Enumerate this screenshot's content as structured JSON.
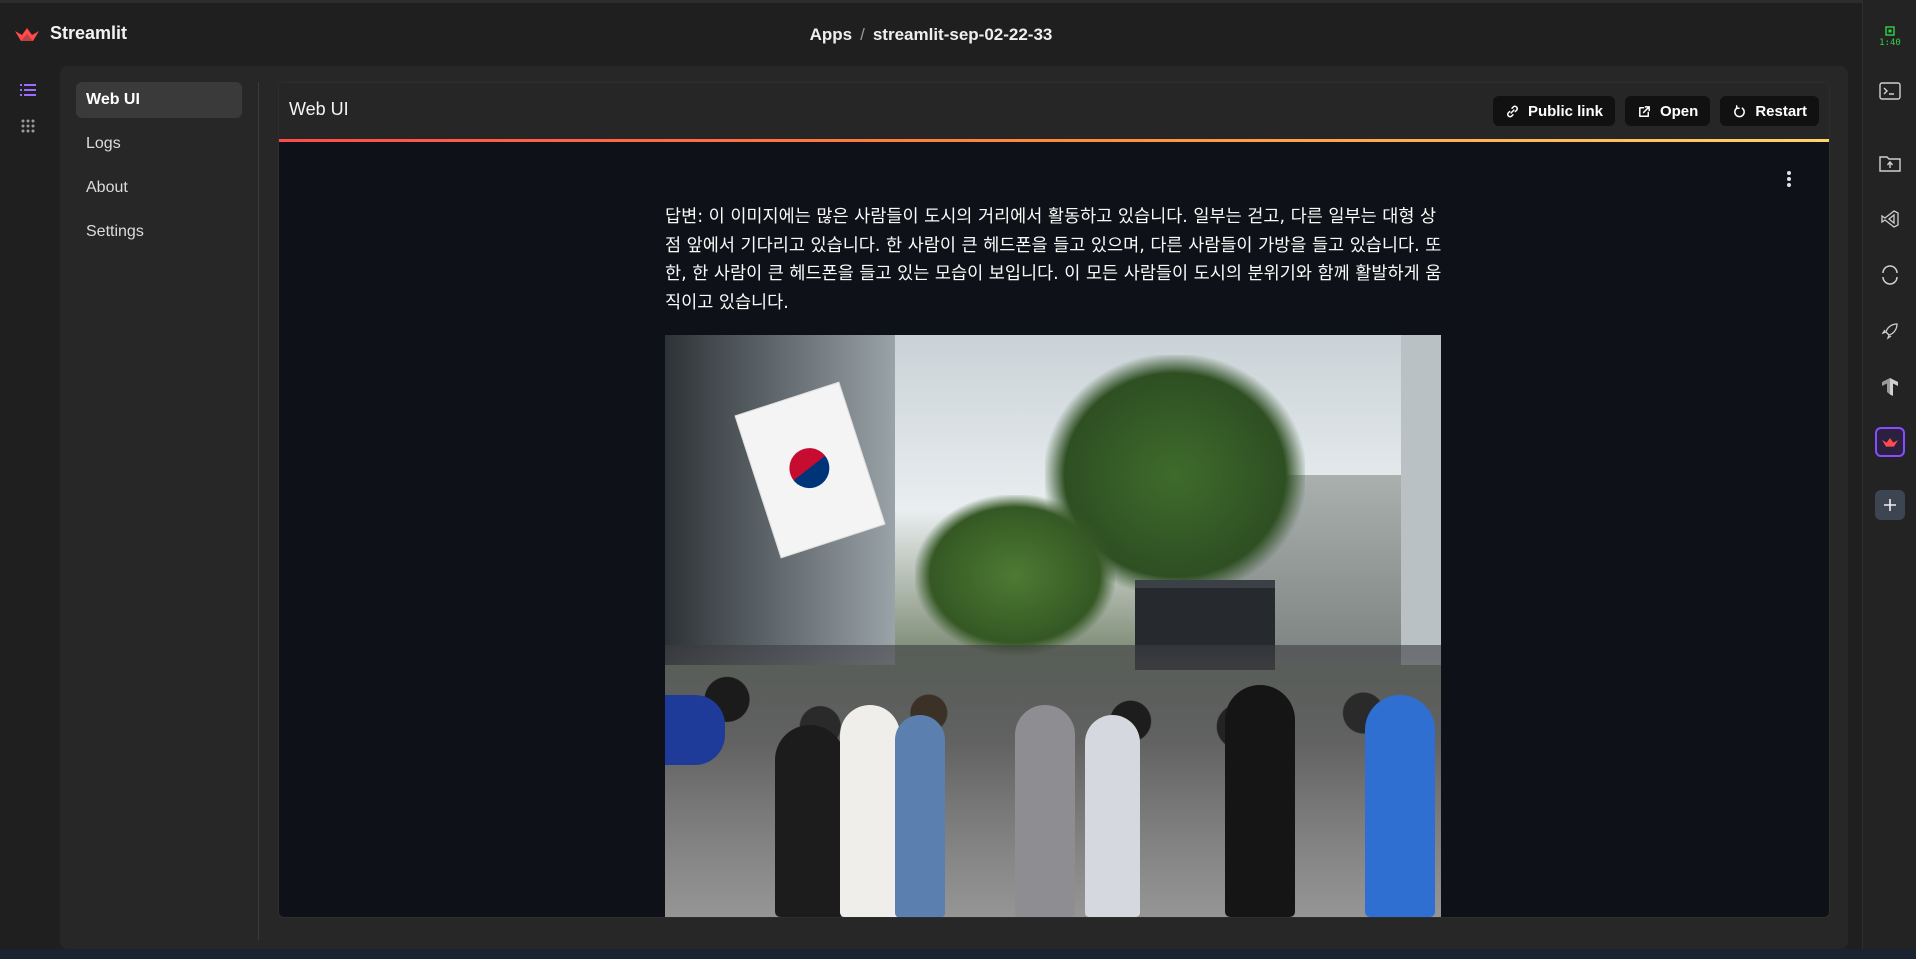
{
  "topbar": {
    "brand": "Streamlit",
    "breadcrumb": [
      "Apps",
      "streamlit-sep-02-22-33"
    ],
    "separator": "/"
  },
  "subnav": {
    "items": [
      {
        "label": "Web UI",
        "active": true
      },
      {
        "label": "Logs",
        "active": false
      },
      {
        "label": "About",
        "active": false
      },
      {
        "label": "Settings",
        "active": false
      }
    ]
  },
  "webframe": {
    "title": "Web UI",
    "buttons": {
      "public_link": "Public link",
      "open": "Open",
      "restart": "Restart"
    }
  },
  "app": {
    "answer": "답변: 이 이미지에는 많은 사람들이 도시의 거리에서 활동하고 있습니다. 일부는 걷고, 다른 일부는 대형 상점 앞에서 기다리고 있습니다. 한 사람이 큰 헤드폰을 들고 있으며, 다른 사람들이 가방을 들고 있습니다. 또한, 한 사람이 큰 헤드폰을 들고 있는 모습이 보입니다. 이 모든 사람들이 도시의 분위기와 함께 활발하게 움직이고 있습니다."
  },
  "rightrail": {
    "timer": "1:40",
    "icons": [
      "terminal-icon",
      "file-transfer-icon",
      "vscode-icon",
      "circle-icon",
      "rocket-icon",
      "tensorflow-icon",
      "streamlit-icon",
      "plus-icon"
    ]
  },
  "colors": {
    "accent": "#ff4b4b",
    "frame_bg": "#0e1117",
    "panel_bg": "#272727",
    "active_nav": "#8a4cff"
  }
}
